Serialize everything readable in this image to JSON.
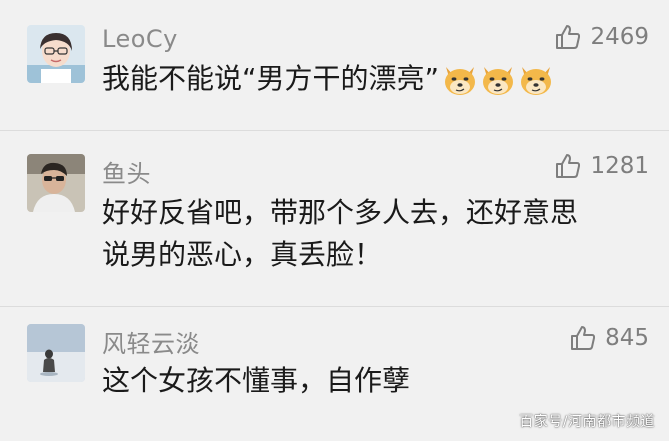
{
  "comments": [
    {
      "username": "LeoCy",
      "likes": "2469",
      "text": "我能不能说“男方干的漂亮”",
      "emoji_count": 3,
      "emoji_icon": "doge-icon"
    },
    {
      "username": "鱼头",
      "likes": "1281",
      "text_line1": "好好反省吧，带那个多人去，还好意思",
      "text_line2": "说男的恶心，真丢脸！"
    },
    {
      "username": "风轻云淡",
      "likes": "845",
      "text": "这个女孩不懂事，自作孽"
    }
  ],
  "watermark": "百家号/河南都市频道",
  "colors": {
    "background": "#f1f1f1",
    "username": "#8a8a8a",
    "text": "#1a1a1a",
    "like": "#7e7e7e"
  },
  "icons": {
    "like": "thumbs-up-icon"
  }
}
